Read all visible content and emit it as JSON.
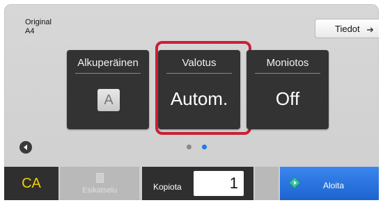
{
  "original": {
    "label": "Original",
    "size": "A4"
  },
  "info_button": {
    "label": "Tiedot"
  },
  "tiles": [
    {
      "title": "Alkuperäinen",
      "value": "A"
    },
    {
      "title": "Valotus",
      "value": "Autom."
    },
    {
      "title": "Moniotos",
      "value": "Off"
    }
  ],
  "pager": {
    "active_page": 2,
    "total_pages": 2
  },
  "bottom_bar": {
    "ca_label": "CA",
    "preview_label": "Esikatselu",
    "copies_label": "Kopiota",
    "copies_value": "1",
    "start_label": "Aloita"
  },
  "colors": {
    "highlight": "#cc1f34",
    "ca_text": "#f5d000",
    "start_bg": "#2a74e0",
    "dot_active": "#1e7bea",
    "dot_inactive": "#8a8a8a"
  }
}
